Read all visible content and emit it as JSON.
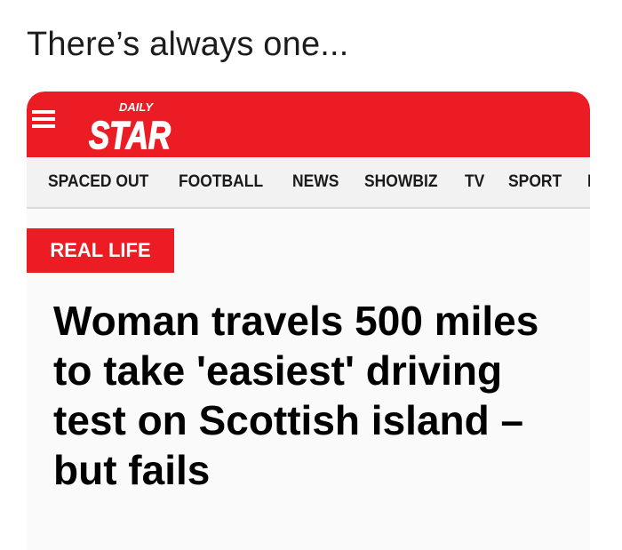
{
  "caption": "There’s always one...",
  "site": {
    "brand_small": "DAILY",
    "brand_large": "STAR",
    "brand_color": "#ec1c24",
    "menu_icon": "hamburger-menu-icon"
  },
  "nav": {
    "items": [
      "SPACED OUT",
      "FOOTBALL",
      "NEWS",
      "SHOWBIZ",
      "TV",
      "SPORT",
      "LI"
    ]
  },
  "article": {
    "category": "REAL LIFE",
    "headline": "Woman travels 500 miles to take 'easiest' driving test on Scottish island – but fails"
  }
}
